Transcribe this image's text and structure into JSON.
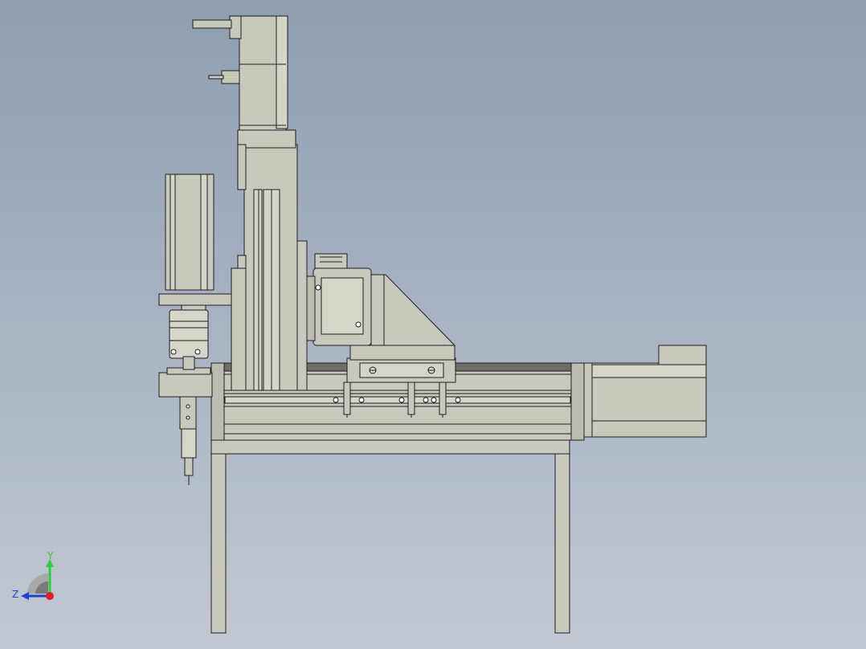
{
  "colors": {
    "part_fill": "#c9c8bc",
    "part_fill_light": "#d6d5c9",
    "part_fill_dark": "#b5b4a8",
    "edge": "#1e1e1e",
    "axis_y": "#2ecc40",
    "axis_z": "#2244cc",
    "axis_x": "#e02020"
  },
  "triad": {
    "y_label": "Y",
    "z_label": "Z"
  }
}
